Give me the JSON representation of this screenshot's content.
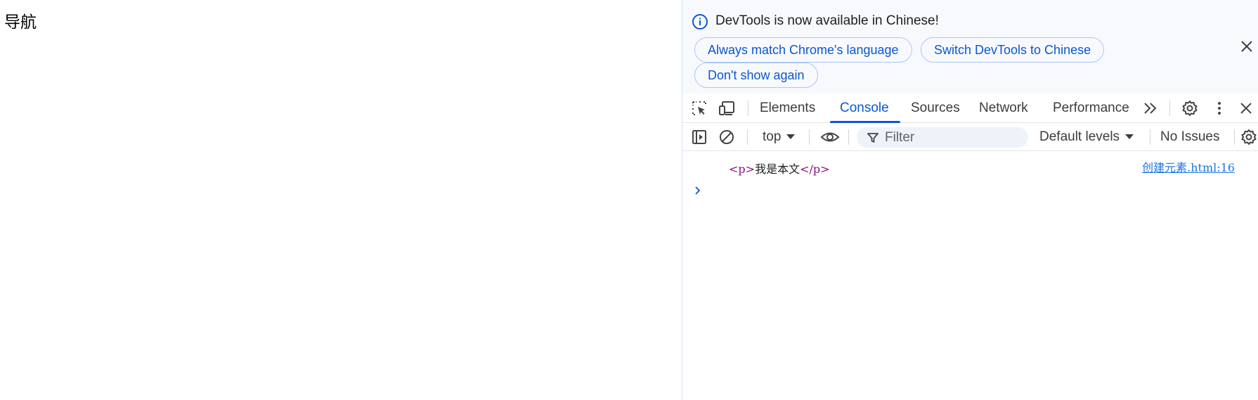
{
  "page": {
    "heading": "导航"
  },
  "infobar": {
    "message": "DevTools is now available in Chinese!",
    "buttons": {
      "always_match": "Always match Chrome's language",
      "switch": "Switch DevTools to Chinese",
      "dont_show": "Don't show again"
    },
    "icons": {
      "info": "info-icon",
      "close": "close-icon"
    }
  },
  "tabs": [
    {
      "label": "Elements",
      "active": false
    },
    {
      "label": "Console",
      "active": true
    },
    {
      "label": "Sources",
      "active": false
    },
    {
      "label": "Network",
      "active": false
    },
    {
      "label": "Performance",
      "active": false
    }
  ],
  "toolbar_icons": [
    "inspect-element-icon",
    "device-toolbar-icon",
    "more-tabs-icon",
    "settings-icon",
    "more-options-icon",
    "close-devtools-icon"
  ],
  "console_toolbar": {
    "context": "top",
    "filter_placeholder": "Filter",
    "levels": "Default levels",
    "issues": "No Issues",
    "icons": [
      "sidebar-toggle-icon",
      "clear-console-icon",
      "live-expression-eye-icon",
      "filter-icon",
      "console-settings-icon"
    ]
  },
  "console": {
    "log": {
      "open_tag": "<p>",
      "text": "我是本文",
      "close_tag": "</p>",
      "source": "创建元素.html:16"
    }
  },
  "colors": {
    "accent": "#0b57d0",
    "infobar_bg": "#f8f9fd",
    "pill_border": "#a8c7fa",
    "tag": "#881280",
    "link": "#1a73e8"
  }
}
